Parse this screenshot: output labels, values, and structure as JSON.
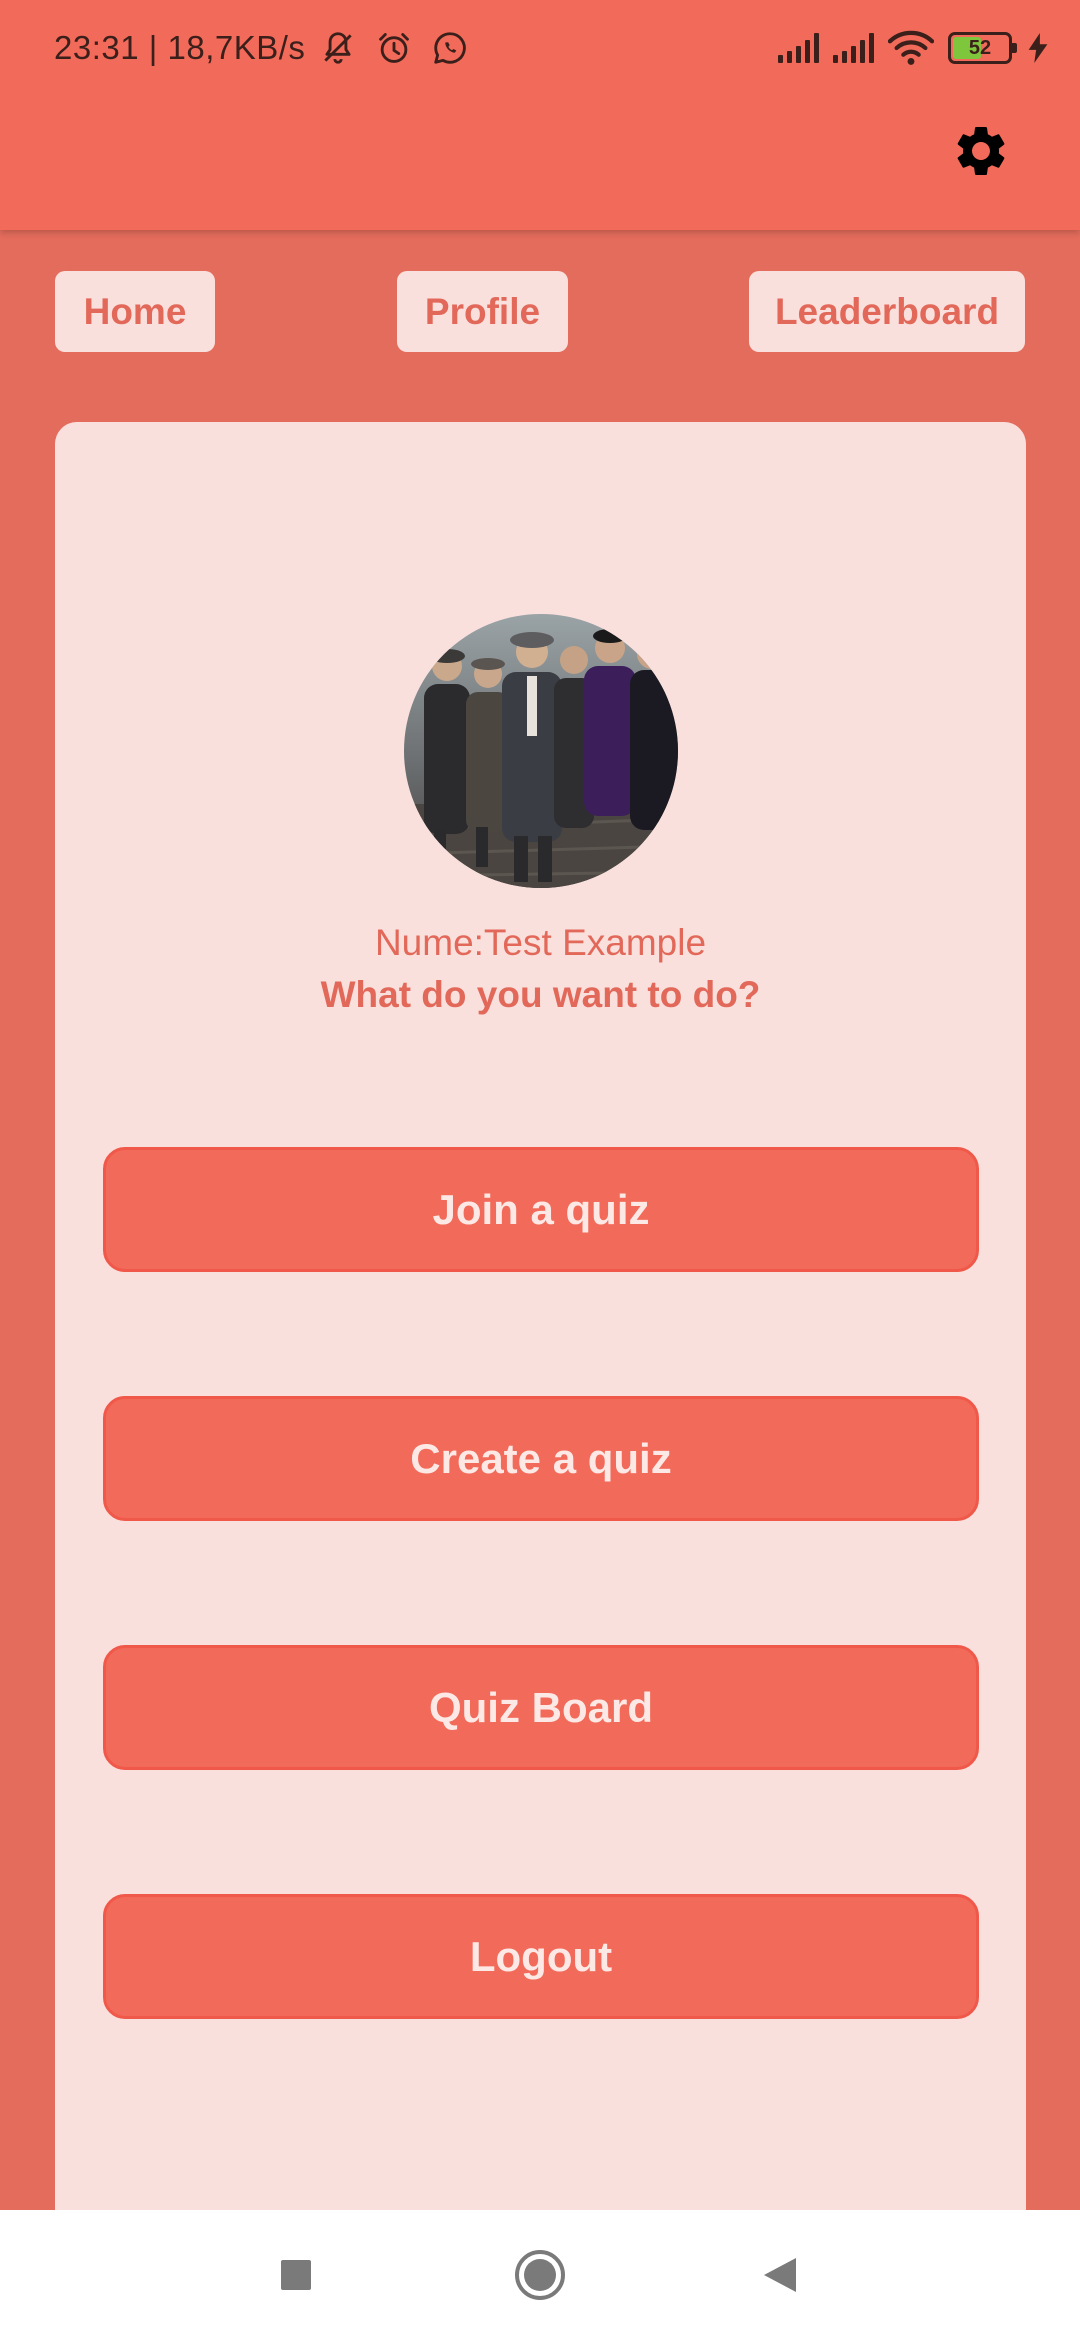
{
  "status_bar": {
    "time_and_speed": "23:31 | 18,7KB/s",
    "battery_level": "52",
    "battery_fraction": 0.52,
    "icons": [
      "bell-off-icon",
      "alarm-icon",
      "whatsapp-icon",
      "signal-icon",
      "signal-icon",
      "wifi-icon",
      "battery-icon",
      "charging-icon"
    ]
  },
  "app_bar": {
    "settings_icon": "gear-icon"
  },
  "nav": {
    "home": "Home",
    "profile": "Profile",
    "leaderboard": "Leaderboard"
  },
  "profile": {
    "name_line": "Nume:Test Example",
    "prompt": "What do you want to do?"
  },
  "actions": {
    "join": "Join a quiz",
    "create": "Create a quiz",
    "board": "Quiz Board",
    "logout": "Logout"
  },
  "system_nav": {
    "icons": [
      "recent-apps-icon",
      "home-icon",
      "back-icon"
    ]
  },
  "colors": {
    "background": "#E46C5C",
    "app_bar": "#F26A59",
    "card": "#FAE0DD",
    "button": "#F26A59",
    "text_accent": "#E2695A",
    "button_text": "#FCE8E5"
  }
}
